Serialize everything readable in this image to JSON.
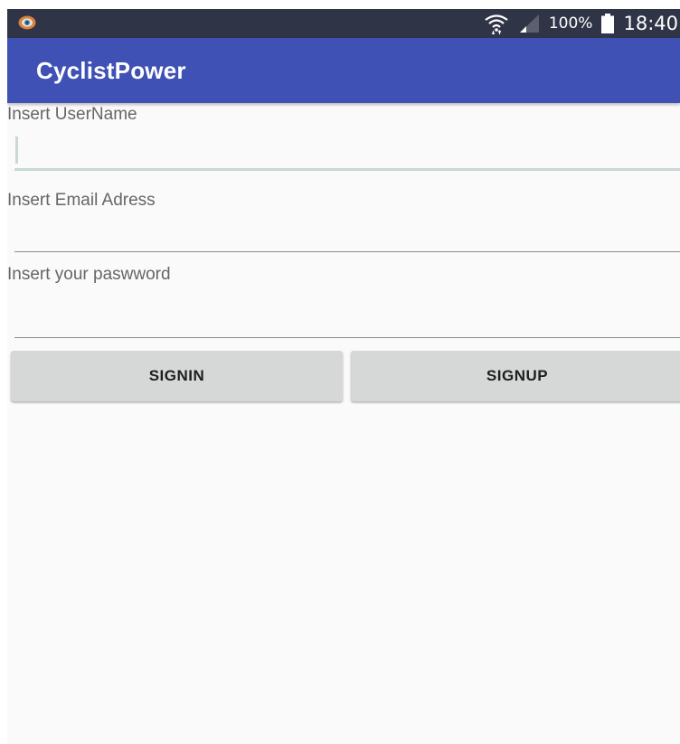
{
  "status_bar": {
    "app_icon": "camera-app-icon",
    "wifi_icon": "wifi-icon",
    "signal_icon": "signal-icon",
    "battery_percent": "100%",
    "battery_icon": "battery-icon",
    "time": "18:40"
  },
  "app_bar": {
    "title": "CyclistPower",
    "color": "#3f51b5"
  },
  "form": {
    "username": {
      "label": "Insert UserName",
      "value": ""
    },
    "email": {
      "label": "Insert Email Adress",
      "value": ""
    },
    "password": {
      "label": "Insert your paswword",
      "value": ""
    }
  },
  "buttons": {
    "signin": "SIGNIN",
    "signup": "SIGNUP"
  }
}
